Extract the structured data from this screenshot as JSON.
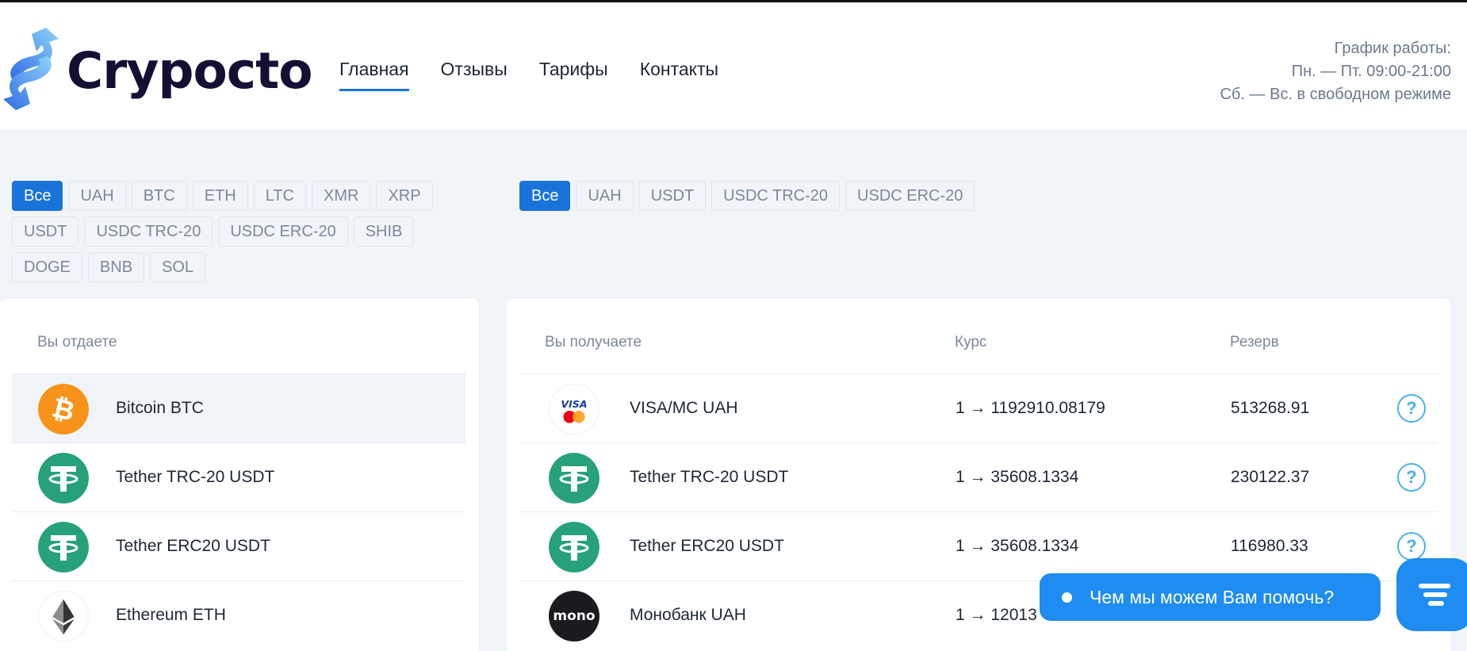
{
  "brand": {
    "name": "Crypocto",
    "accent": "#1a73d9",
    "logo_gradient": [
      "#2f6ce3",
      "#8fd3f8"
    ]
  },
  "nav": [
    {
      "label": "Главная",
      "active": true
    },
    {
      "label": "Отзывы",
      "active": false
    },
    {
      "label": "Тарифы",
      "active": false
    },
    {
      "label": "Контакты",
      "active": false
    }
  ],
  "schedule": {
    "title": "График работы:",
    "weekdays": "Пн. — Пт. 09:00-21:00",
    "weekend": "Сб. — Вс. в свободном режиме"
  },
  "give_filters": [
    "Все",
    "UAH",
    "BTC",
    "ETH",
    "LTC",
    "XMR",
    "XRP",
    "USDT",
    "USDC TRC-20",
    "USDC ERC-20",
    "SHIB",
    "DOGE",
    "BNB",
    "SOL"
  ],
  "get_filters": [
    "Все",
    "UAH",
    "USDT",
    "USDC TRC-20",
    "USDC ERC-20"
  ],
  "give": {
    "header": "Вы отдаете",
    "items": [
      {
        "name": "Bitcoin BTC",
        "icon": "bitcoin-icon",
        "selected": true
      },
      {
        "name": "Tether TRC-20 USDT",
        "icon": "tether-icon",
        "selected": false
      },
      {
        "name": "Tether ERC20 USDT",
        "icon": "tether-icon",
        "selected": false
      },
      {
        "name": "Ethereum ETH",
        "icon": "ethereum-icon",
        "selected": false
      }
    ]
  },
  "get": {
    "header_receive": "Вы получаете",
    "header_rate": "Курс",
    "header_reserve": "Резерв",
    "items": [
      {
        "name": "VISA/MC UAH",
        "icon": "visa-mastercard-icon",
        "rate": "1 → 1192910.08179",
        "reserve": "513268.91"
      },
      {
        "name": "Tether TRC-20 USDT",
        "icon": "tether-icon",
        "rate": "1 → 35608.1334",
        "reserve": "230122.37"
      },
      {
        "name": "Tether ERC20 USDT",
        "icon": "tether-icon",
        "rate": "1 → 35608.1334",
        "reserve": "116980.33"
      },
      {
        "name": "Монобанк UAH",
        "icon": "monobank-icon",
        "rate": "1 → 12013",
        "reserve": "",
        "logo_text": "mono"
      }
    ]
  },
  "help_glyph": "?",
  "chat": {
    "message": "Чем мы можем Вам помочь?",
    "color": "#1e8cf0"
  }
}
